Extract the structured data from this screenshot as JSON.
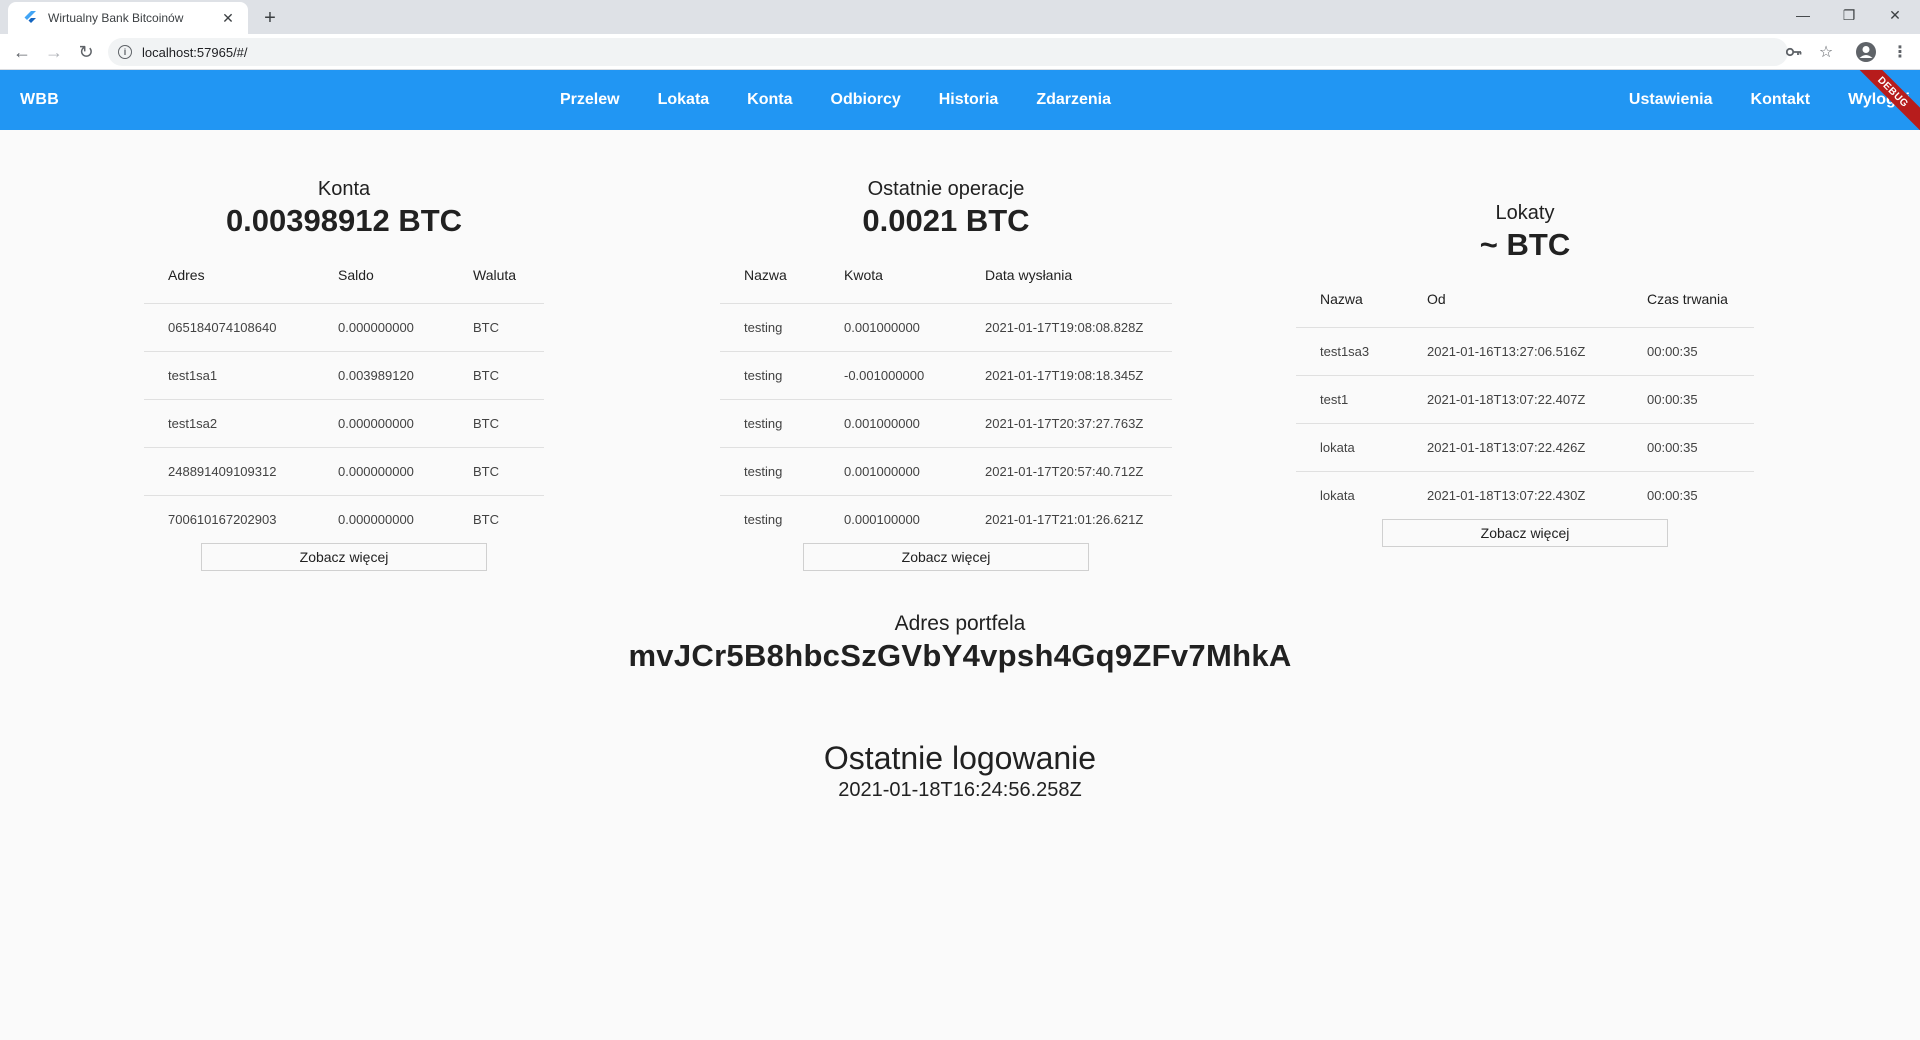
{
  "browser": {
    "tab_title": "Wirtualny Bank Bitcoinów",
    "url": "localhost:57965/#/"
  },
  "appbar": {
    "brand": "WBB",
    "nav": [
      "Przelew",
      "Lokata",
      "Konta",
      "Odbiorcy",
      "Historia",
      "Zdarzenia"
    ],
    "nav_right": [
      "Ustawienia",
      "Kontakt",
      "Wyloguj"
    ],
    "debug": "DEBUG",
    "color": "#2196f3"
  },
  "accounts": {
    "title": "Konta",
    "amount": "0.00398912 BTC",
    "headers": [
      "Adres",
      "Saldo",
      "Waluta"
    ],
    "rows": [
      [
        "065184074108640",
        "0.000000000",
        "BTC"
      ],
      [
        "test1sa1",
        "0.003989120",
        "BTC"
      ],
      [
        "test1sa2",
        "0.000000000",
        "BTC"
      ],
      [
        "248891409109312",
        "0.000000000",
        "BTC"
      ],
      [
        "700610167202903",
        "0.000000000",
        "BTC"
      ]
    ],
    "more": "Zobacz więcej"
  },
  "operations": {
    "title": "Ostatnie operacje",
    "amount": "0.0021 BTC",
    "headers": [
      "Nazwa",
      "Kwota",
      "Data wysłania"
    ],
    "rows": [
      [
        "testing",
        "0.001000000",
        "2021-01-17T19:08:08.828Z"
      ],
      [
        "testing",
        "-0.001000000",
        "2021-01-17T19:08:18.345Z"
      ],
      [
        "testing",
        "0.001000000",
        "2021-01-17T20:37:27.763Z"
      ],
      [
        "testing",
        "0.001000000",
        "2021-01-17T20:57:40.712Z"
      ],
      [
        "testing",
        "0.000100000",
        "2021-01-17T21:01:26.621Z"
      ]
    ],
    "more": "Zobacz więcej"
  },
  "deposits": {
    "title": "Lokaty",
    "amount": "~ BTC",
    "headers": [
      "Nazwa",
      "Od",
      "Czas trwania"
    ],
    "rows": [
      [
        "test1sa3",
        "2021-01-16T13:27:06.516Z",
        "00:00:35"
      ],
      [
        "test1",
        "2021-01-18T13:07:22.407Z",
        "00:00:35"
      ],
      [
        "lokata",
        "2021-01-18T13:07:22.426Z",
        "00:00:35"
      ],
      [
        "lokata",
        "2021-01-18T13:07:22.430Z",
        "00:00:35"
      ]
    ],
    "more": "Zobacz więcej"
  },
  "wallet": {
    "label": "Adres portfela",
    "address": "mvJCr5B8hbcSzGVbY4vpsh4Gq9ZFv7MhkA"
  },
  "last_login": {
    "label": "Ostatnie logowanie",
    "value": "2021-01-18T16:24:56.258Z"
  }
}
